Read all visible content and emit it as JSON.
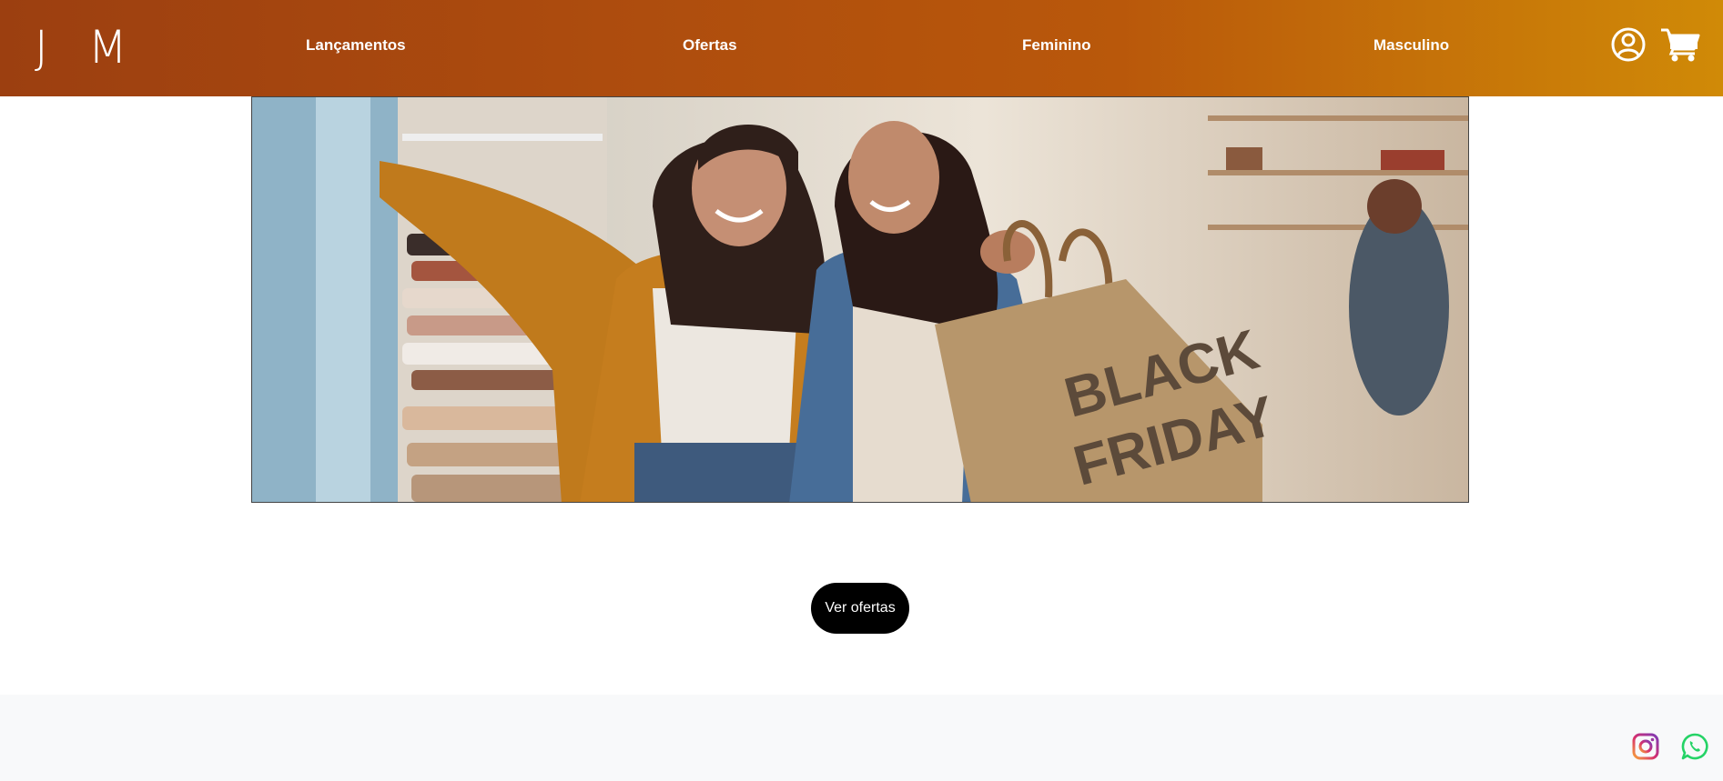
{
  "header": {
    "logo": "J M",
    "nav": [
      {
        "label": "Lançamentos"
      },
      {
        "label": "Ofertas"
      },
      {
        "label": "Feminino"
      },
      {
        "label": "Masculino"
      }
    ],
    "icons": [
      "user-icon",
      "cart-icon"
    ],
    "gradient": [
      "#9c3f10",
      "#d08a07"
    ]
  },
  "banner": {
    "bag_text_1": "BLACK",
    "bag_text_2": "FRIDAY"
  },
  "cta": {
    "label": "Ver ofertas"
  },
  "footer": {
    "icons": [
      "instagram-icon",
      "whatsapp-icon"
    ]
  }
}
